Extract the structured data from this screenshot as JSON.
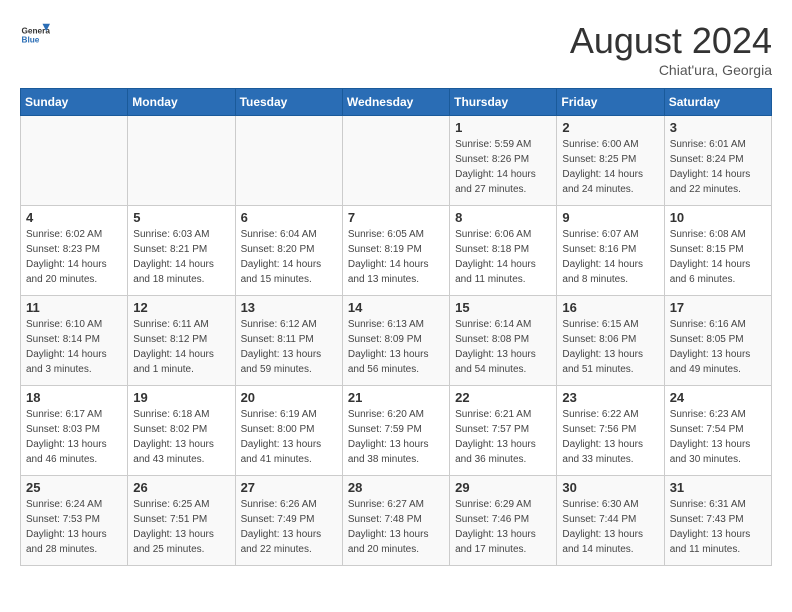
{
  "logo": {
    "general": "General",
    "blue": "Blue"
  },
  "title": {
    "month_year": "August 2024",
    "location": "Chiat'ura, Georgia"
  },
  "days_of_week": [
    "Sunday",
    "Monday",
    "Tuesday",
    "Wednesday",
    "Thursday",
    "Friday",
    "Saturday"
  ],
  "weeks": [
    [
      {
        "day": "",
        "info": ""
      },
      {
        "day": "",
        "info": ""
      },
      {
        "day": "",
        "info": ""
      },
      {
        "day": "",
        "info": ""
      },
      {
        "day": "1",
        "info": "Sunrise: 5:59 AM\nSunset: 8:26 PM\nDaylight: 14 hours\nand 27 minutes."
      },
      {
        "day": "2",
        "info": "Sunrise: 6:00 AM\nSunset: 8:25 PM\nDaylight: 14 hours\nand 24 minutes."
      },
      {
        "day": "3",
        "info": "Sunrise: 6:01 AM\nSunset: 8:24 PM\nDaylight: 14 hours\nand 22 minutes."
      }
    ],
    [
      {
        "day": "4",
        "info": "Sunrise: 6:02 AM\nSunset: 8:23 PM\nDaylight: 14 hours\nand 20 minutes."
      },
      {
        "day": "5",
        "info": "Sunrise: 6:03 AM\nSunset: 8:21 PM\nDaylight: 14 hours\nand 18 minutes."
      },
      {
        "day": "6",
        "info": "Sunrise: 6:04 AM\nSunset: 8:20 PM\nDaylight: 14 hours\nand 15 minutes."
      },
      {
        "day": "7",
        "info": "Sunrise: 6:05 AM\nSunset: 8:19 PM\nDaylight: 14 hours\nand 13 minutes."
      },
      {
        "day": "8",
        "info": "Sunrise: 6:06 AM\nSunset: 8:18 PM\nDaylight: 14 hours\nand 11 minutes."
      },
      {
        "day": "9",
        "info": "Sunrise: 6:07 AM\nSunset: 8:16 PM\nDaylight: 14 hours\nand 8 minutes."
      },
      {
        "day": "10",
        "info": "Sunrise: 6:08 AM\nSunset: 8:15 PM\nDaylight: 14 hours\nand 6 minutes."
      }
    ],
    [
      {
        "day": "11",
        "info": "Sunrise: 6:10 AM\nSunset: 8:14 PM\nDaylight: 14 hours\nand 3 minutes."
      },
      {
        "day": "12",
        "info": "Sunrise: 6:11 AM\nSunset: 8:12 PM\nDaylight: 14 hours\nand 1 minute."
      },
      {
        "day": "13",
        "info": "Sunrise: 6:12 AM\nSunset: 8:11 PM\nDaylight: 13 hours\nand 59 minutes."
      },
      {
        "day": "14",
        "info": "Sunrise: 6:13 AM\nSunset: 8:09 PM\nDaylight: 13 hours\nand 56 minutes."
      },
      {
        "day": "15",
        "info": "Sunrise: 6:14 AM\nSunset: 8:08 PM\nDaylight: 13 hours\nand 54 minutes."
      },
      {
        "day": "16",
        "info": "Sunrise: 6:15 AM\nSunset: 8:06 PM\nDaylight: 13 hours\nand 51 minutes."
      },
      {
        "day": "17",
        "info": "Sunrise: 6:16 AM\nSunset: 8:05 PM\nDaylight: 13 hours\nand 49 minutes."
      }
    ],
    [
      {
        "day": "18",
        "info": "Sunrise: 6:17 AM\nSunset: 8:03 PM\nDaylight: 13 hours\nand 46 minutes."
      },
      {
        "day": "19",
        "info": "Sunrise: 6:18 AM\nSunset: 8:02 PM\nDaylight: 13 hours\nand 43 minutes."
      },
      {
        "day": "20",
        "info": "Sunrise: 6:19 AM\nSunset: 8:00 PM\nDaylight: 13 hours\nand 41 minutes."
      },
      {
        "day": "21",
        "info": "Sunrise: 6:20 AM\nSunset: 7:59 PM\nDaylight: 13 hours\nand 38 minutes."
      },
      {
        "day": "22",
        "info": "Sunrise: 6:21 AM\nSunset: 7:57 PM\nDaylight: 13 hours\nand 36 minutes."
      },
      {
        "day": "23",
        "info": "Sunrise: 6:22 AM\nSunset: 7:56 PM\nDaylight: 13 hours\nand 33 minutes."
      },
      {
        "day": "24",
        "info": "Sunrise: 6:23 AM\nSunset: 7:54 PM\nDaylight: 13 hours\nand 30 minutes."
      }
    ],
    [
      {
        "day": "25",
        "info": "Sunrise: 6:24 AM\nSunset: 7:53 PM\nDaylight: 13 hours\nand 28 minutes."
      },
      {
        "day": "26",
        "info": "Sunrise: 6:25 AM\nSunset: 7:51 PM\nDaylight: 13 hours\nand 25 minutes."
      },
      {
        "day": "27",
        "info": "Sunrise: 6:26 AM\nSunset: 7:49 PM\nDaylight: 13 hours\nand 22 minutes."
      },
      {
        "day": "28",
        "info": "Sunrise: 6:27 AM\nSunset: 7:48 PM\nDaylight: 13 hours\nand 20 minutes."
      },
      {
        "day": "29",
        "info": "Sunrise: 6:29 AM\nSunset: 7:46 PM\nDaylight: 13 hours\nand 17 minutes."
      },
      {
        "day": "30",
        "info": "Sunrise: 6:30 AM\nSunset: 7:44 PM\nDaylight: 13 hours\nand 14 minutes."
      },
      {
        "day": "31",
        "info": "Sunrise: 6:31 AM\nSunset: 7:43 PM\nDaylight: 13 hours\nand 11 minutes."
      }
    ]
  ]
}
